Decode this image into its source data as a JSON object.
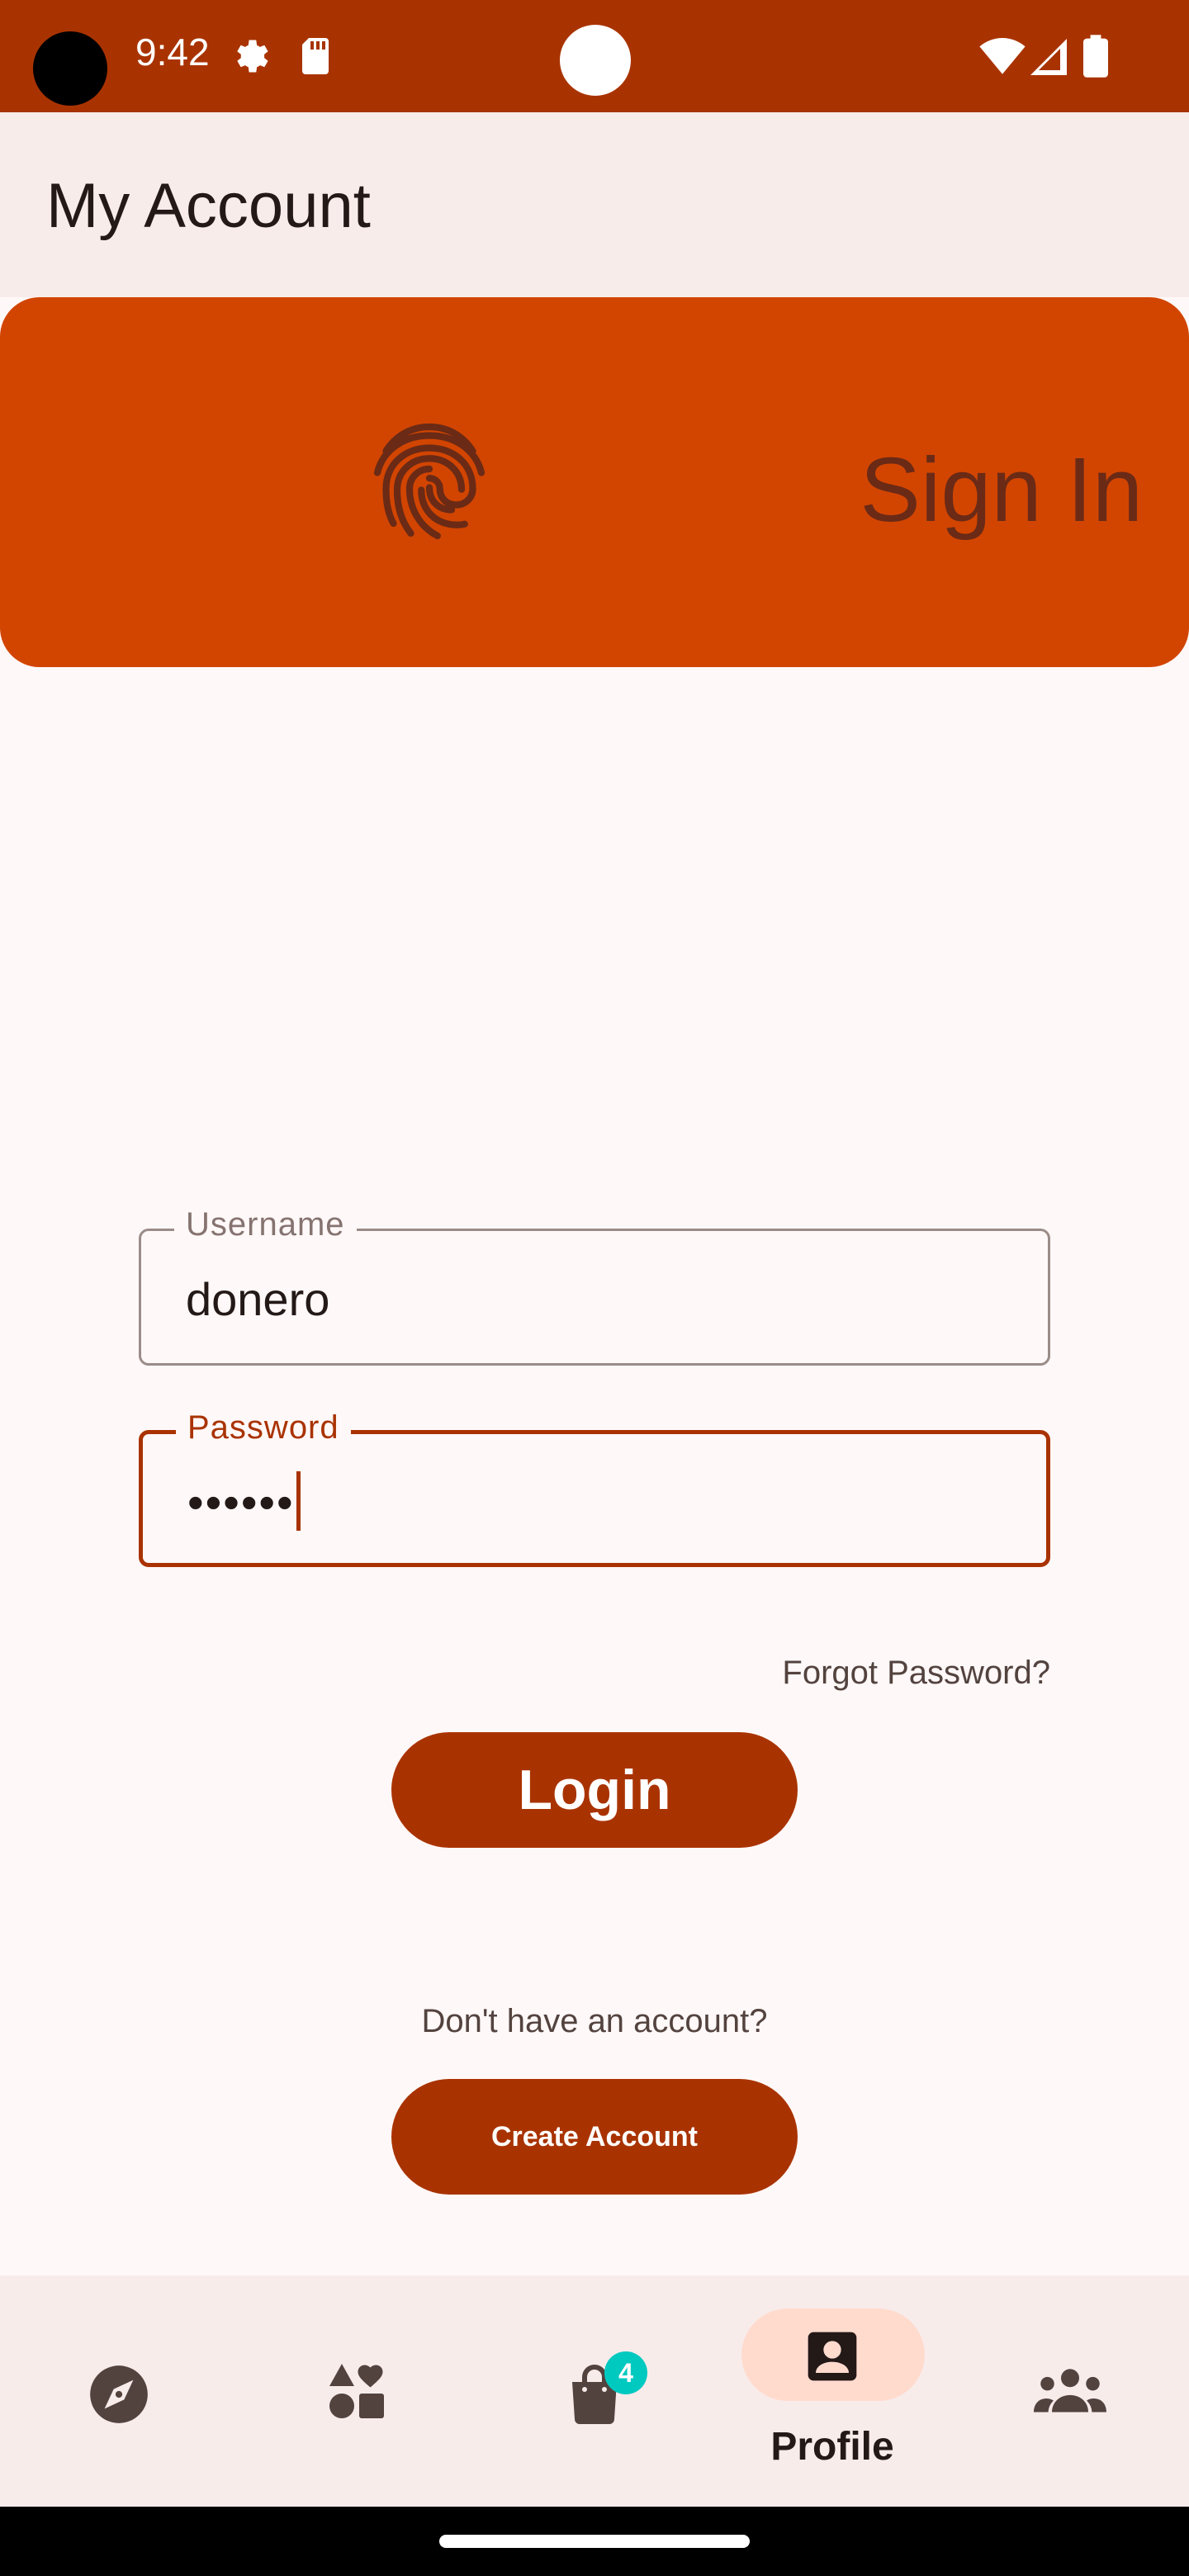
{
  "status_bar": {
    "time": "9:42",
    "icons": [
      "settings-gear-icon",
      "sd-card-icon",
      "wifi-icon",
      "cell-signal-icon",
      "battery-icon"
    ],
    "background": "#A93300"
  },
  "app_bar": {
    "title": "My Account"
  },
  "signin_card": {
    "title": "Sign In",
    "icon": "fingerprint-icon",
    "background": "#D24500"
  },
  "form": {
    "username": {
      "label": "Username",
      "value": "donero"
    },
    "password": {
      "label": "Password",
      "value": "••••••"
    },
    "forgot_password": "Forgot Password?",
    "login_label": "Login",
    "no_account_text": "Don't have an account?",
    "create_account_label": "Create Account"
  },
  "bottom_nav": {
    "items": [
      {
        "icon": "compass-explore-icon",
        "label": ""
      },
      {
        "icon": "categories-shapes-icon",
        "label": ""
      },
      {
        "icon": "shopping-bag-icon",
        "label": "",
        "badge": "4"
      },
      {
        "icon": "profile-icon",
        "label": "Profile",
        "selected": true
      },
      {
        "icon": "community-people-icon",
        "label": ""
      }
    ]
  },
  "colors": {
    "primary": "#A93300",
    "accent_card": "#D24500",
    "badge": "#00C9C0",
    "selected_pill": "#FFDBCE"
  }
}
